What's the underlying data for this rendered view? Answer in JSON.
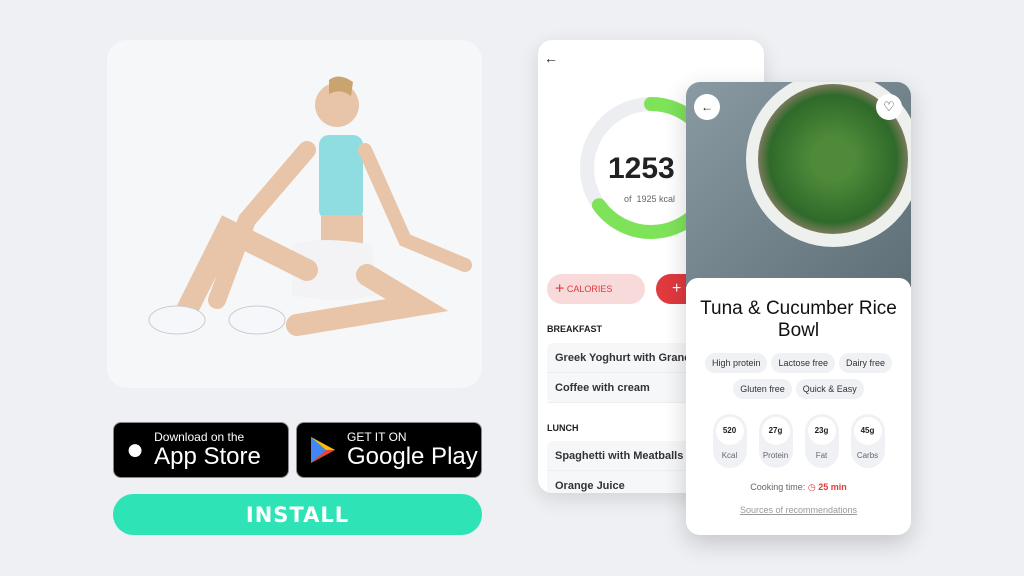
{
  "badges": {
    "appstore_small": "Download on the",
    "appstore_big": "App Store",
    "play_small": "GET IT ON",
    "play_big": "Google Play"
  },
  "install_label": "INSTALL",
  "tracker": {
    "consumed": "1253",
    "goal_text": "of  1925 kcal",
    "progress": 0.651,
    "calories_label": "CALORIES",
    "sections": [
      {
        "title": "BREAKFAST",
        "items": [
          "Greek Yoghurt with Granola",
          "Coffee with cream"
        ]
      },
      {
        "title": "LUNCH",
        "items": [
          "Spaghetti with Meatballs",
          "Orange Juice"
        ]
      }
    ]
  },
  "recipe": {
    "title": "Tuna & Cucumber Rice Bowl",
    "tags": [
      "High protein",
      "Lactose free",
      "Dairy free",
      "Gluten free",
      "Quick & Easy"
    ],
    "macros": [
      {
        "value": "520",
        "label": "Kcal"
      },
      {
        "value": "27g",
        "label": "Protein"
      },
      {
        "value": "23g",
        "label": "Fat"
      },
      {
        "value": "45g",
        "label": "Carbs"
      }
    ],
    "cooking_label": "Cooking time:",
    "cooking_time": "25 min",
    "sources_link": "Sources of recommendations"
  },
  "colors": {
    "accent_green": "#2ee3b6",
    "ring_green": "#7fe35a",
    "red": "#e0393e"
  }
}
